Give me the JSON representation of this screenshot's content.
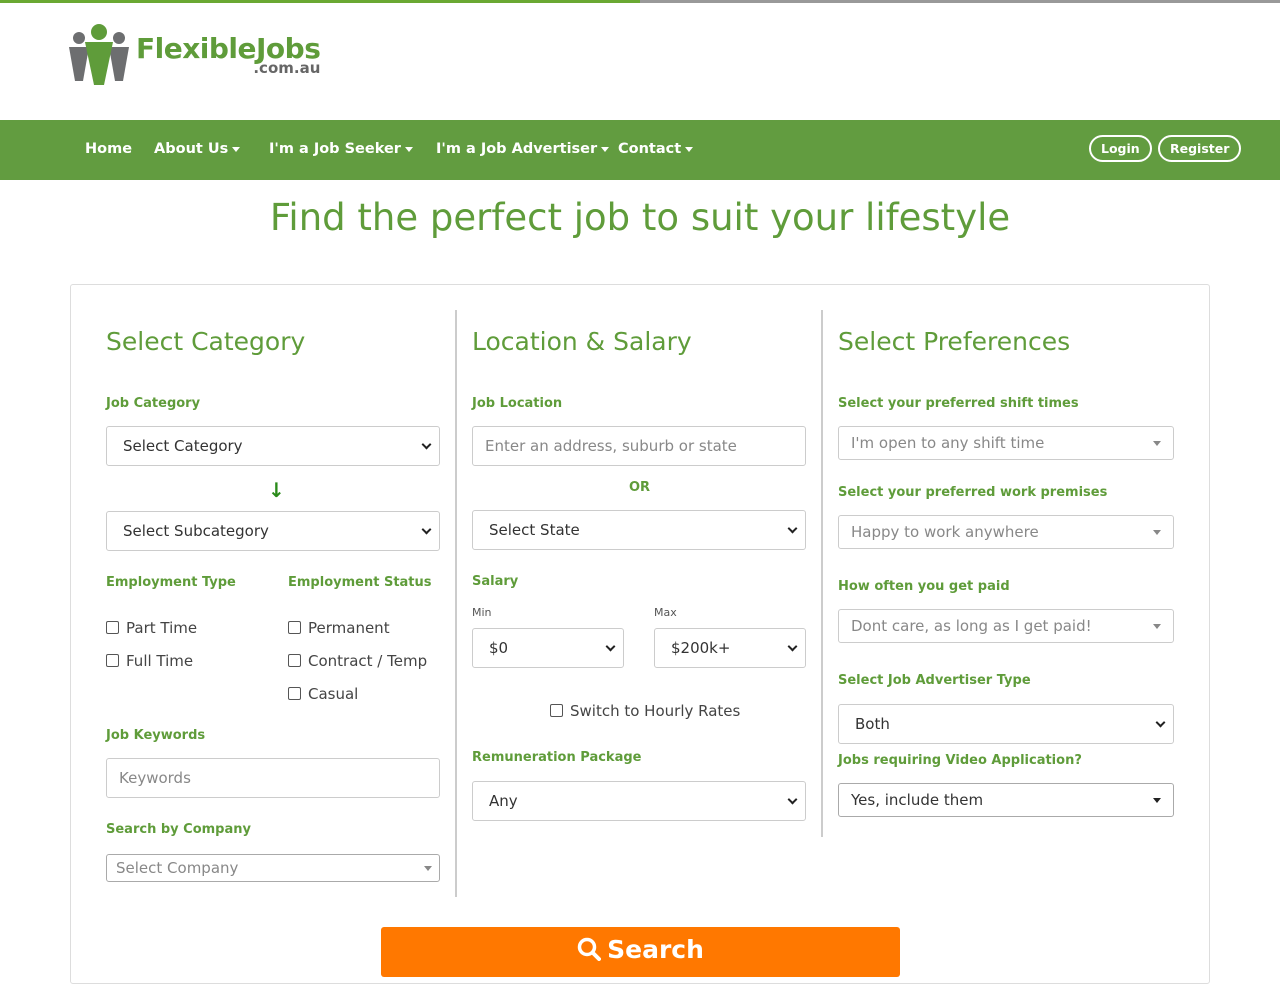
{
  "page_progress": 0.5,
  "logo": {
    "name_part1": "Flexible",
    "name_part2": "Jobs",
    "domain": ".com.au"
  },
  "nav": {
    "items": [
      {
        "label": "Home",
        "dropdown": false
      },
      {
        "label": "About Us",
        "dropdown": true
      },
      {
        "label": "I'm a Job Seeker",
        "dropdown": true
      },
      {
        "label": "I'm a Job Advertiser",
        "dropdown": true
      },
      {
        "label": "Contact",
        "dropdown": true
      }
    ],
    "login_label": "Login",
    "register_label": "Register"
  },
  "hero": {
    "title": "Find the perfect job to suit your lifestyle"
  },
  "category": {
    "title": "Select Category",
    "job_category_label": "Job Category",
    "category_value": "Select Category",
    "subcategory_value": "Select Subcategory",
    "employment_type_label": "Employment Type",
    "employment_type_options": [
      "Part Time",
      "Full Time"
    ],
    "employment_status_label": "Employment Status",
    "employment_status_options": [
      "Permanent",
      "Contract / Temp",
      "Casual"
    ],
    "keywords_label": "Job Keywords",
    "keywords_placeholder": "Keywords",
    "company_label": "Search by Company",
    "company_value": "Select Company"
  },
  "location": {
    "title": "Location & Salary",
    "job_location_label": "Job Location",
    "location_placeholder": "Enter an address, suburb or state",
    "or_label": "OR",
    "state_value": "Select State",
    "salary_label": "Salary",
    "min_label": "Min",
    "min_value": "$0",
    "max_label": "Max",
    "max_value": "$200k+",
    "hourly_label": "Switch to Hourly Rates",
    "remuneration_label": "Remuneration Package",
    "remuneration_value": "Any"
  },
  "preferences": {
    "title": "Select Preferences",
    "shift_label": "Select your preferred shift times",
    "shift_value": "I'm open to any shift time",
    "premises_label": "Select your preferred work premises",
    "premises_value": "Happy to work anywhere",
    "paid_label": "How often you get paid",
    "paid_value": "Dont care, as long as I get paid!",
    "advertiser_label": "Select Job Advertiser Type",
    "advertiser_value": "Both",
    "video_label": "Jobs requiring Video Application?",
    "video_value": "Yes, include them"
  },
  "search_button": {
    "label": "Search",
    "icon": "search-icon"
  },
  "colors": {
    "brand_green": "#5f9c3a",
    "nav_green": "#629c40",
    "search_orange": "#ff7800"
  }
}
